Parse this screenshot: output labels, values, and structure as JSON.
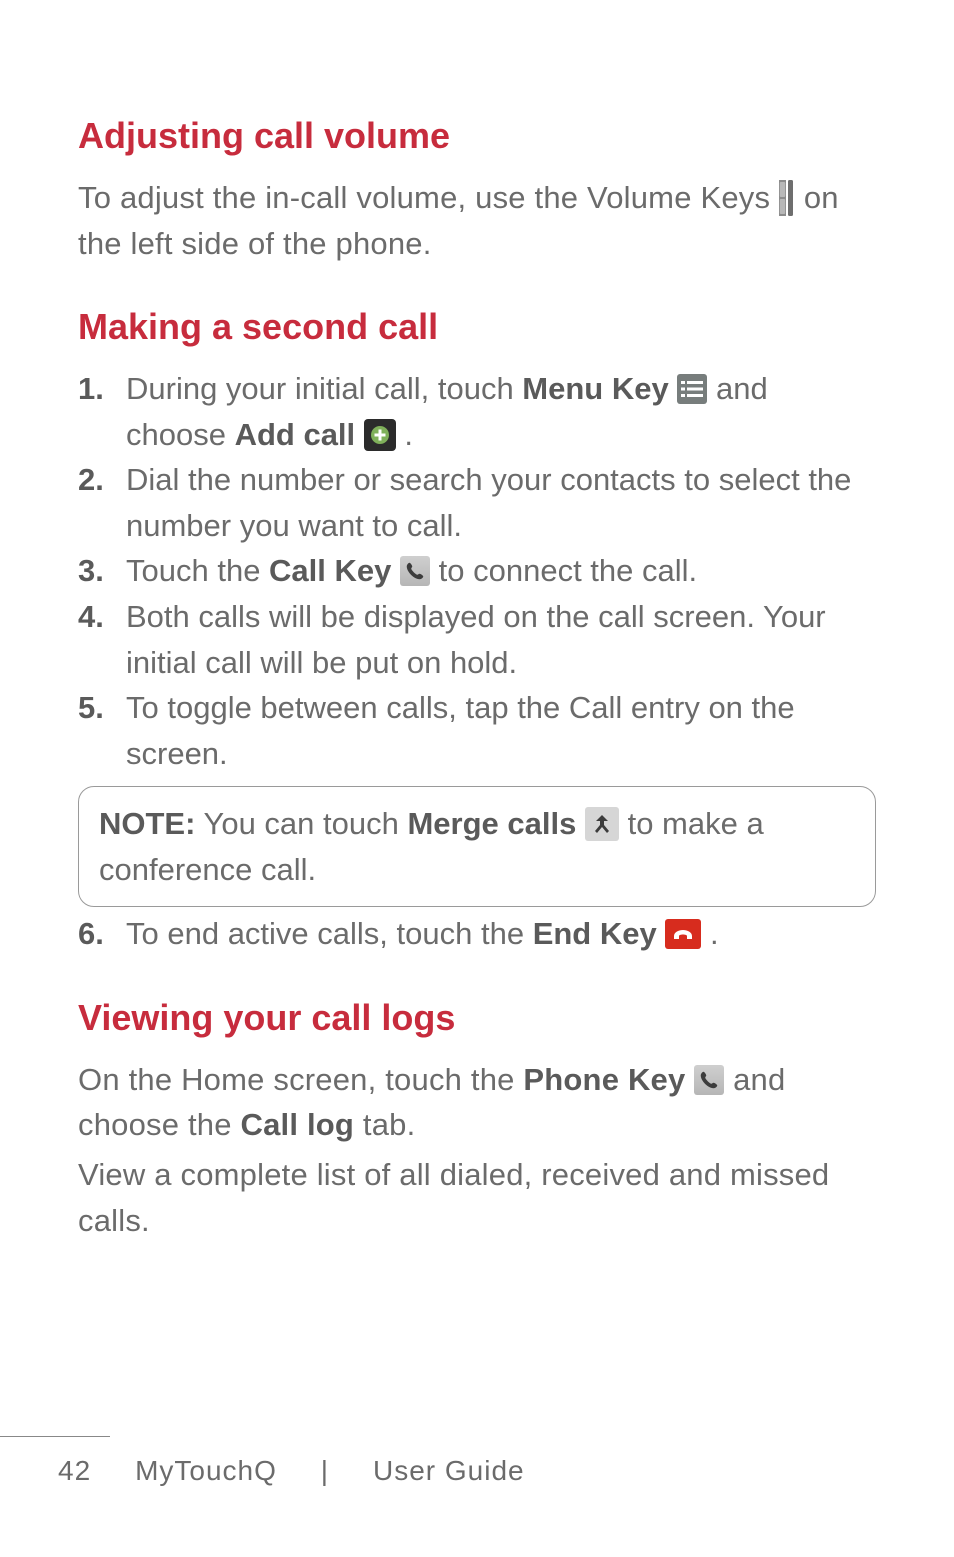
{
  "section1": {
    "heading": "Adjusting call volume",
    "para_a": "To adjust the in-call volume, use the Volume Keys ",
    "para_b": " on the left side of the phone."
  },
  "section2": {
    "heading": "Making a second call",
    "step1_a": "During your initial call, touch ",
    "step1_menukey": "Menu Key",
    "step1_b": " and choose ",
    "step1_addcall": "Add call",
    "step1_c": ".",
    "step2": "Dial the number or search your contacts to select the number you want to call.",
    "step3_a": "Touch the ",
    "step3_callkey": "Call Key",
    "step3_b": " to connect the call.",
    "step4": "Both calls will be displayed on the call screen. Your initial call will be put on hold.",
    "step5": "To toggle between calls, tap the Call entry on the screen.",
    "note_label": "NOTE:",
    "note_a": " You can touch ",
    "note_merge": "Merge calls",
    "note_b": " to make a conference call.",
    "step6_a": "To end active calls, touch the ",
    "step6_endkey": "End Key",
    "step6_b": "."
  },
  "section3": {
    "heading": "Viewing your call logs",
    "para1_a": "On the Home screen, touch the ",
    "para1_phonekey": "Phone Key",
    "para1_b": " and choose the ",
    "para1_calllog": "Call log",
    "para1_c": " tab.",
    "para2": "View a complete list of all dialed, received and missed calls."
  },
  "footer": {
    "page": "42",
    "sep": "|",
    "product": "MyTouchQ",
    "title": "User Guide"
  },
  "nums": {
    "n1": "1.",
    "n2": "2.",
    "n3": "3.",
    "n4": "4.",
    "n5": "5.",
    "n6": "6."
  }
}
